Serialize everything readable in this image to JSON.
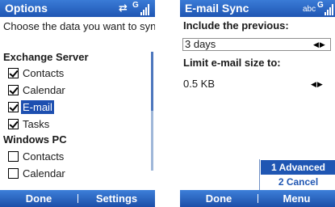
{
  "left": {
    "title": "Options",
    "prompt": "Choose the data you want to sync:",
    "groups": [
      {
        "label": "Exchange Server",
        "items": [
          {
            "label": "Contacts",
            "checked": true
          },
          {
            "label": "Calendar",
            "checked": true
          },
          {
            "label": "E-mail",
            "checked": true,
            "selected": true
          },
          {
            "label": "Tasks",
            "checked": true
          }
        ]
      },
      {
        "label": "Windows PC",
        "items": [
          {
            "label": "Contacts",
            "checked": false
          },
          {
            "label": "Calendar",
            "checked": false
          }
        ]
      }
    ],
    "softkeys": {
      "left": "Done",
      "right": "Settings"
    }
  },
  "right": {
    "title": "E-mail Sync",
    "input_mode": "abc",
    "include_label": "Include the previous:",
    "include_value": "3 days",
    "limit_label": "Limit e-mail size to:",
    "limit_value": "0.5 KB",
    "menu": [
      {
        "label": "1 Advanced",
        "highlighted": true
      },
      {
        "label": "2 Cancel",
        "highlighted": false
      }
    ],
    "softkeys": {
      "left": "Done",
      "right": "Menu"
    }
  },
  "colors": {
    "titlebar": "#2a66c4",
    "selection": "#1d4fb0",
    "menu_text": "#1f56b3"
  }
}
